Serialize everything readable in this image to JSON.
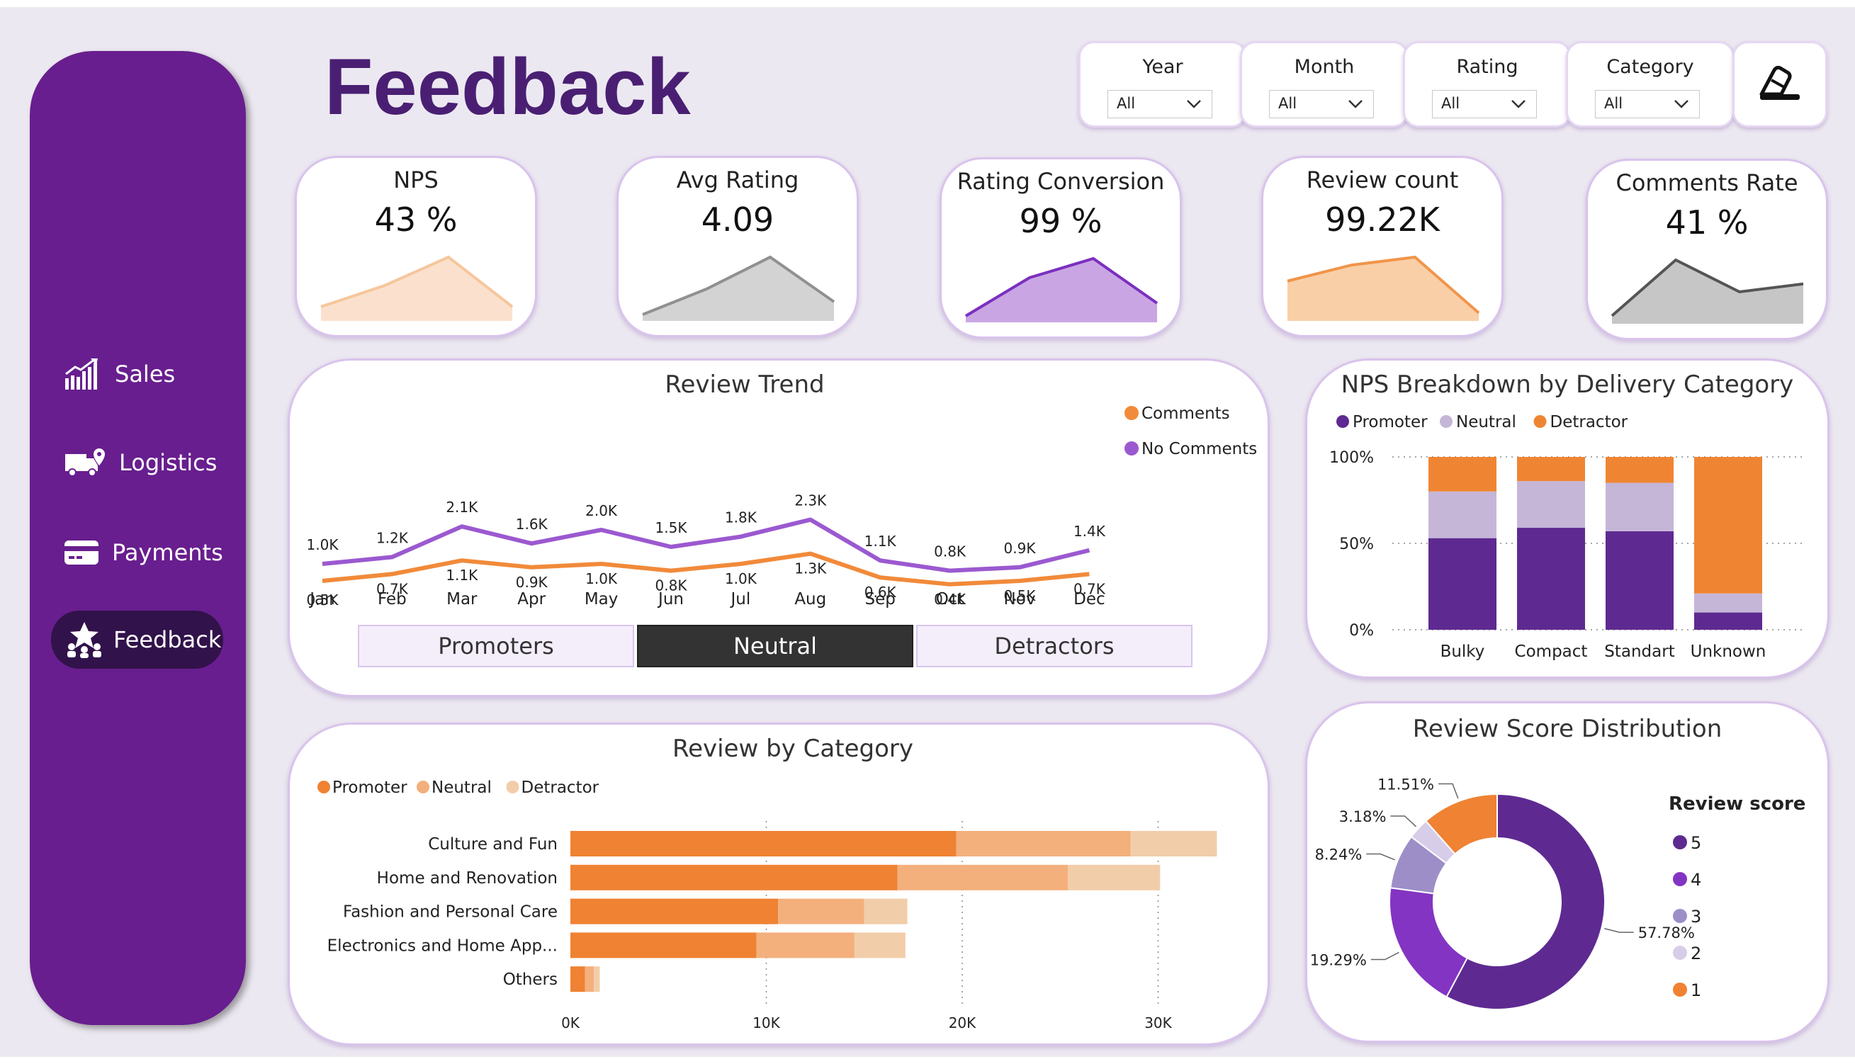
{
  "page_title": "Feedback",
  "nav": [
    {
      "label": "Sales",
      "icon": "bar-chart-icon"
    },
    {
      "label": "Logistics",
      "icon": "truck-location-icon"
    },
    {
      "label": "Payments",
      "icon": "credit-card-icon"
    },
    {
      "label": "Feedback",
      "icon": "star-people-icon",
      "active": true
    }
  ],
  "filters": [
    {
      "label": "Year",
      "value": "All"
    },
    {
      "label": "Month",
      "value": "All"
    },
    {
      "label": "Rating",
      "value": "All"
    },
    {
      "label": "Category",
      "value": "All"
    }
  ],
  "reset_icon": "eraser-icon",
  "kpis": [
    {
      "title": "NPS",
      "value": "43 %",
      "trend": [
        2,
        5,
        9,
        2
      ],
      "color": "#f6c69c",
      "fill": "#fbe1cd"
    },
    {
      "title": "Avg Rating",
      "value": "4.09",
      "trend": [
        1,
        5,
        10,
        3
      ],
      "color": "#909090",
      "fill": "#d3d3d3"
    },
    {
      "title": "Rating Conversion",
      "value": "99 %",
      "trend": [
        1,
        7,
        10,
        3
      ],
      "color": "#7b2fbf",
      "fill": "#c9a6e3"
    },
    {
      "title": "Review count",
      "value": "99.22K",
      "trend": [
        5,
        7,
        8,
        1
      ],
      "color": "#f0954a",
      "fill": "#f9cfa8"
    },
    {
      "title": "Comments Rate",
      "value": "41 %",
      "trend": [
        1,
        8,
        4,
        5
      ],
      "color": "#555555",
      "fill": "#c6c6c6"
    }
  ],
  "review_trend": {
    "title": "Review Trend",
    "legend": [
      {
        "name": "Comments",
        "color": "#f18a3a"
      },
      {
        "name": "No Comments",
        "color": "#9b59d0"
      }
    ],
    "buttons": [
      "Promoters",
      "Neutral",
      "Detractors"
    ],
    "active_button": "Neutral",
    "chart_data": {
      "type": "line",
      "categories": [
        "Jan",
        "Feb",
        "Mar",
        "Apr",
        "May",
        "Jun",
        "Jul",
        "Aug",
        "Sep",
        "Oct",
        "Nov",
        "Dec"
      ],
      "series": [
        {
          "name": "No Comments",
          "values": [
            1.0,
            1.2,
            2.1,
            1.6,
            2.0,
            1.5,
            1.8,
            2.3,
            1.1,
            0.8,
            0.9,
            1.4
          ],
          "labels": [
            "1.0K",
            "1.2K",
            "2.1K",
            "1.6K",
            "2.0K",
            "1.5K",
            "1.8K",
            "2.3K",
            "1.1K",
            "0.8K",
            "0.9K",
            "1.4K"
          ]
        },
        {
          "name": "Comments",
          "values": [
            0.5,
            0.7,
            1.1,
            0.9,
            1.0,
            0.8,
            1.0,
            1.3,
            0.6,
            0.4,
            0.5,
            0.7
          ],
          "labels": [
            "0.5K",
            "0.7K",
            "1.1K",
            "0.9K",
            "1.0K",
            "0.8K",
            "1.0K",
            "1.3K",
            "0.6K",
            "0.4K",
            "0.5K",
            "0.7K"
          ]
        }
      ]
    }
  },
  "nps_breakdown": {
    "title": "NPS Breakdown by Delivery Category",
    "legend": [
      {
        "name": "Promoter",
        "color": "#5e2a91"
      },
      {
        "name": "Neutral",
        "color": "#c5b6d8"
      },
      {
        "name": "Detractor",
        "color": "#ef8533"
      }
    ],
    "chart_data": {
      "type": "bar",
      "stacked": "100%",
      "categories": [
        "Bulky",
        "Compact",
        "Standart",
        "Unknown"
      ],
      "yticks": [
        "100%",
        "50%",
        "0%"
      ],
      "series": [
        {
          "name": "Promoter",
          "values": [
            53,
            59,
            57,
            10
          ]
        },
        {
          "name": "Neutral",
          "values": [
            27,
            27,
            28,
            11
          ]
        },
        {
          "name": "Detractor",
          "values": [
            20,
            14,
            15,
            79
          ]
        }
      ]
    }
  },
  "review_by_category": {
    "title": "Review by Category",
    "legend": [
      {
        "name": "Promoter",
        "color": "#ef8233"
      },
      {
        "name": "Neutral",
        "color": "#f3b07d"
      },
      {
        "name": "Detractor",
        "color": "#f2cda9"
      }
    ],
    "chart_data": {
      "type": "bar",
      "orientation": "horizontal",
      "stacked": true,
      "categories": [
        "Culture and Fun",
        "Home and Renovation",
        "Fashion and Personal Care",
        "Electronics and Home App...",
        "Others"
      ],
      "xticks": [
        "0K",
        "10K",
        "20K",
        "30K"
      ],
      "xlim": [
        0,
        30000
      ],
      "series": [
        {
          "name": "Promoter",
          "values": [
            19700,
            16700,
            10600,
            9500,
            750
          ]
        },
        {
          "name": "Neutral",
          "values": [
            8900,
            8700,
            4400,
            5000,
            450
          ]
        },
        {
          "name": "Detractor",
          "values": [
            4400,
            4700,
            2200,
            2600,
            300
          ]
        }
      ]
    }
  },
  "score_distribution": {
    "title": "Review Score Distribution",
    "legend_title": "Review score",
    "chart_data": {
      "type": "pie",
      "donut": true,
      "slices": [
        {
          "label": "5",
          "value": 57.78,
          "text": "57.78%",
          "color": "#5e2a91"
        },
        {
          "label": "4",
          "value": 19.29,
          "text": "19.29%",
          "color": "#8334c3"
        },
        {
          "label": "3",
          "value": 8.24,
          "text": "8.24%",
          "color": "#9d8ec7"
        },
        {
          "label": "2",
          "value": 3.18,
          "text": "3.18%",
          "color": "#d7cde8"
        },
        {
          "label": "1",
          "value": 11.51,
          "text": "11.51%",
          "color": "#ef8233"
        }
      ]
    }
  }
}
